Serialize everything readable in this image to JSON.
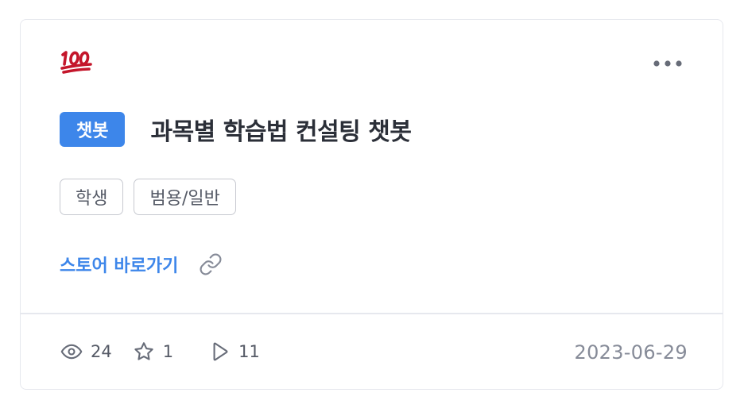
{
  "card": {
    "emoji_name": "hundred-points-icon",
    "badge_label": "챗봇",
    "title": "과목별 학습법 컨설팅 챗봇",
    "tags": [
      "학생",
      "범용/일반"
    ],
    "store_link_label": "스토어 바로가기",
    "stats": {
      "views": "24",
      "stars": "1",
      "plays": "11"
    },
    "date": "2023-06-29"
  },
  "colors": {
    "accent": "#3d86ea",
    "title": "#2b2f38",
    "muted": "#868b98",
    "border": "#e6e8ee",
    "emoji_red": "#c4162b"
  }
}
